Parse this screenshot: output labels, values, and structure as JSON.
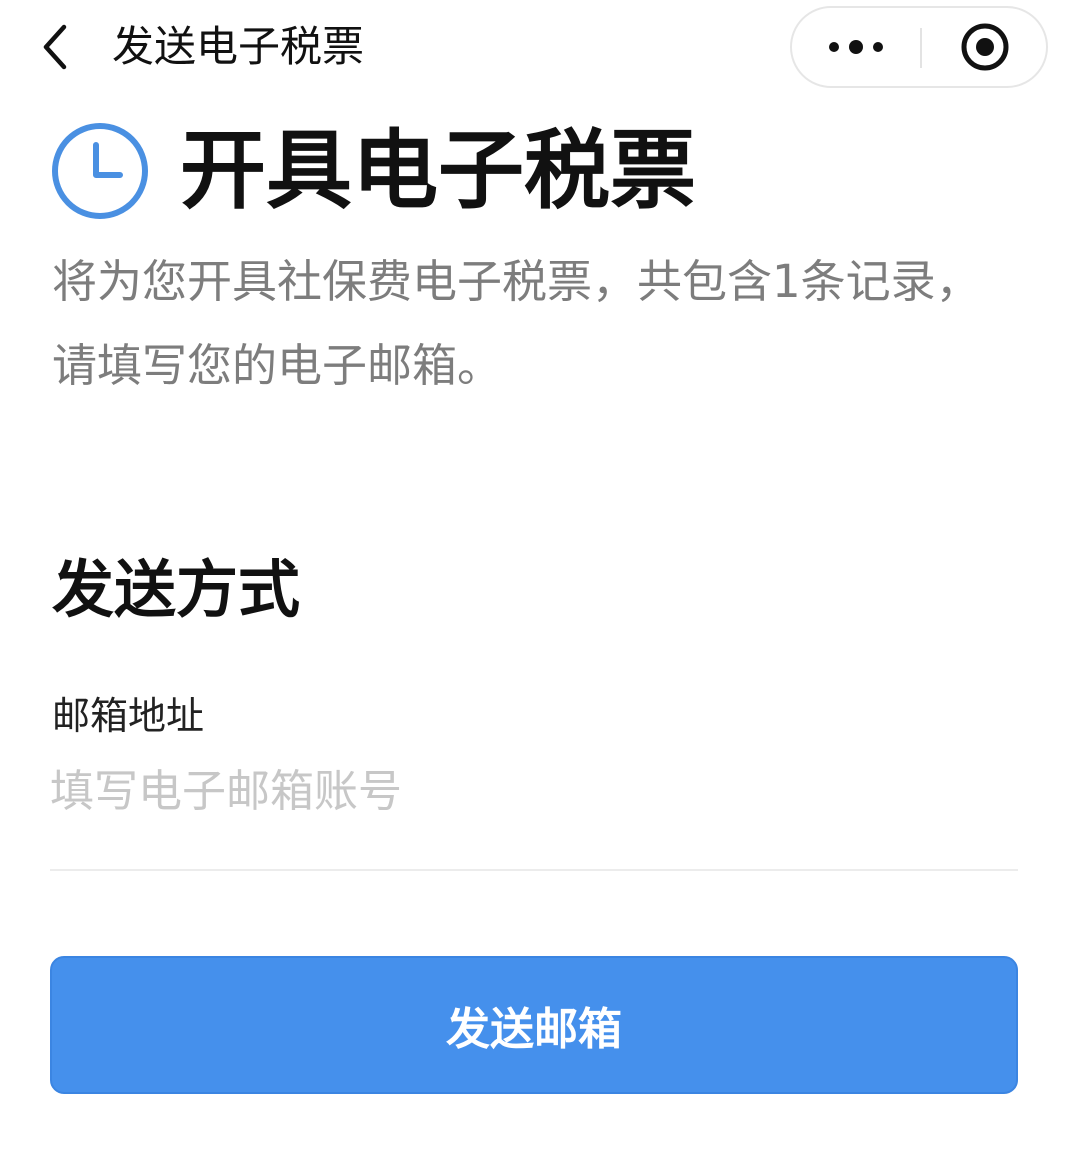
{
  "nav": {
    "title": "发送电子税票",
    "back_icon": "chevron-left-icon",
    "more_icon": "more-dots-icon",
    "close_icon": "target-circle-icon"
  },
  "header": {
    "icon": "clock-icon",
    "title": "开具电子税票"
  },
  "description": "将为您开具社保费电子税票，共包含1条记录，请填写您的电子邮箱。",
  "section": {
    "title": "发送方式"
  },
  "email_field": {
    "label": "邮箱地址",
    "value": "",
    "placeholder": "填写电子邮箱账号"
  },
  "send_button": {
    "label": "发送邮箱"
  },
  "colors": {
    "accent": "#4590ec",
    "clock_icon": "#4a90e2",
    "description_text": "#7d7d7d",
    "placeholder_text": "#c7c7c7"
  }
}
